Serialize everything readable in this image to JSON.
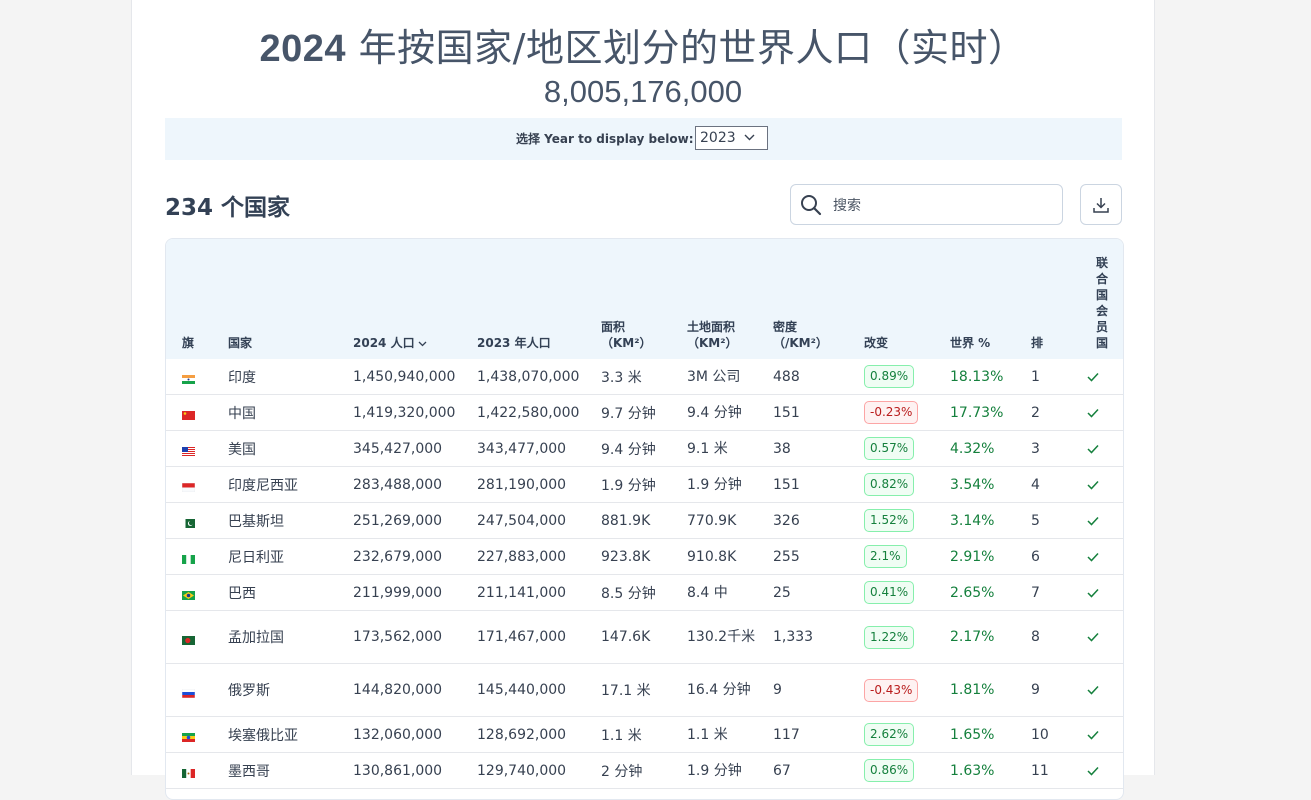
{
  "header": {
    "title_year": "2024",
    "title_rest": " 年按国家/地区划分的世界人口（实时）",
    "population": "8,005,176,000"
  },
  "year_selector": {
    "label": "选择 Year to display below:",
    "value": "2023"
  },
  "toolbar": {
    "count_title": "234 个国家",
    "search_placeholder": "搜索"
  },
  "table": {
    "headers": {
      "flag": "旗",
      "country": "国家",
      "pop2024": "2024 人口",
      "pop2023": "2023 年人口",
      "area_line1": "面积",
      "area_line2": "（KM²）",
      "land_line1": "土地面积",
      "land_line2": "（KM²）",
      "density_line1": "密度",
      "density_line2": "（/KM²）",
      "change": "改变",
      "world": "世界 %",
      "rank": "排",
      "un": [
        "联",
        "合",
        "国",
        "会",
        "员",
        "国"
      ]
    },
    "rows": [
      {
        "flag": "india",
        "country": "印度",
        "pop2024": "1,450,940,000",
        "pop2023": "1,438,070,000",
        "area": "3.3 米",
        "land": "3M 公司",
        "density": "488",
        "change": "0.89%",
        "change_dir": "pos",
        "world": "18.13%",
        "rank": "1",
        "un": "✓"
      },
      {
        "flag": "china",
        "country": "中国",
        "pop2024": "1,419,320,000",
        "pop2023": "1,422,580,000",
        "area": "9.7 分钟",
        "land": "9.4 分钟",
        "density": "151",
        "change": "-0.23%",
        "change_dir": "neg",
        "world": "17.73%",
        "rank": "2",
        "un": "✓"
      },
      {
        "flag": "usa",
        "country": "美国",
        "pop2024": "345,427,000",
        "pop2023": "343,477,000",
        "area": "9.4 分钟",
        "land": "9.1 米",
        "density": "38",
        "change": "0.57%",
        "change_dir": "pos",
        "world": "4.32%",
        "rank": "3",
        "un": "✓"
      },
      {
        "flag": "indonesia",
        "country": "印度尼西亚",
        "pop2024": "283,488,000",
        "pop2023": "281,190,000",
        "area": "1.9 分钟",
        "land": "1.9 分钟",
        "density": "151",
        "change": "0.82%",
        "change_dir": "pos",
        "world": "3.54%",
        "rank": "4",
        "un": "✓"
      },
      {
        "flag": "pakistan",
        "country": "巴基斯坦",
        "pop2024": "251,269,000",
        "pop2023": "247,504,000",
        "area": "881.9K",
        "land": "770.9K",
        "density": "326",
        "change": "1.52%",
        "change_dir": "pos",
        "world": "3.14%",
        "rank": "5",
        "un": "✓"
      },
      {
        "flag": "nigeria",
        "country": "尼日利亚",
        "pop2024": "232,679,000",
        "pop2023": "227,883,000",
        "area": "923.8K",
        "land": "910.8K",
        "density": "255",
        "change": "2.1%",
        "change_dir": "pos",
        "world": "2.91%",
        "rank": "6",
        "un": "✓"
      },
      {
        "flag": "brazil",
        "country": "巴西",
        "pop2024": "211,999,000",
        "pop2023": "211,141,000",
        "area": "8.5 分钟",
        "land": "8.4 中",
        "density": "25",
        "change": "0.41%",
        "change_dir": "pos",
        "world": "2.65%",
        "rank": "7",
        "un": "✓"
      },
      {
        "flag": "bangladesh",
        "country": "孟加拉国",
        "pop2024": "173,562,000",
        "pop2023": "171,467,000",
        "area": "147.6K",
        "land": "130.2千米",
        "density": "1,333",
        "change": "1.22%",
        "change_dir": "pos",
        "world": "2.17%",
        "rank": "8",
        "un": "✓"
      },
      {
        "flag": "russia",
        "country": "俄罗斯",
        "pop2024": "144,820,000",
        "pop2023": "145,440,000",
        "area": "17.1 米",
        "land": "16.4 分钟",
        "density": "9",
        "change": "-0.43%",
        "change_dir": "neg",
        "world": "1.81%",
        "rank": "9",
        "un": "✓"
      },
      {
        "flag": "ethiopia",
        "country": "埃塞俄比亚",
        "pop2024": "132,060,000",
        "pop2023": "128,692,000",
        "area": "1.1 米",
        "land": "1.1 米",
        "density": "117",
        "change": "2.62%",
        "change_dir": "pos",
        "world": "1.65%",
        "rank": "10",
        "un": "✓"
      },
      {
        "flag": "mexico",
        "country": "墨西哥",
        "pop2024": "130,861,000",
        "pop2023": "129,740,000",
        "area": "2 分钟",
        "land": "1.9 分钟",
        "density": "67",
        "change": "0.86%",
        "change_dir": "pos",
        "world": "1.63%",
        "rank": "11",
        "un": "✓"
      }
    ]
  },
  "colors": {
    "accent_bg": "#eef6fc",
    "positive": "#15803d",
    "negative": "#b91c1c",
    "title": "#475569"
  }
}
